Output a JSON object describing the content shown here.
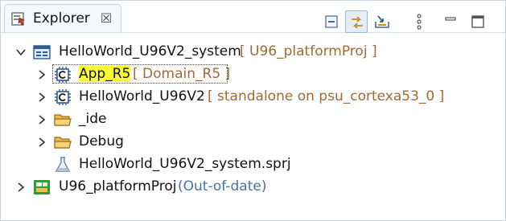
{
  "view": {
    "title": "Explorer",
    "close_glyph": "☒",
    "icons": {
      "view": "explorer-view-icon",
      "collapse_all": "collapse-all-icon",
      "link_with_editor": "link-with-editor-icon",
      "import": "import-icon",
      "menu": "view-menu-icon",
      "minimize": "minimize-icon",
      "maximize": "maximize-icon"
    }
  },
  "tree": [
    {
      "label": "HelloWorld_U96V2_system",
      "deco": "[ U96_platformProj ]",
      "deco_color": "#a06a34",
      "icon": "system-project-icon",
      "expanded": true
    },
    {
      "label": "App_R5",
      "deco": "[ Domain_R5 ]",
      "deco_color": "#a06a34",
      "icon": "application-project-icon",
      "expanded": false,
      "highlighted": true,
      "selected": true
    },
    {
      "label": "HelloWorld_U96V2",
      "deco": "[ standalone on psu_cortexa53_0 ]",
      "deco_color": "#a06a34",
      "icon": "application-project-icon",
      "expanded": false
    },
    {
      "label": "_ide",
      "deco": "",
      "icon": "folder-icon",
      "expanded": false
    },
    {
      "label": "Debug",
      "deco": "",
      "icon": "folder-icon",
      "expanded": false
    },
    {
      "label": "HelloWorld_U96V2_system.sprj",
      "deco": "",
      "icon": "flask-icon"
    },
    {
      "label": "U96_platformProj",
      "deco": "(Out-of-date)",
      "deco_color": "#4673a6",
      "icon": "platform-project-icon",
      "expanded": false
    }
  ],
  "colors": {
    "highlight": "#ffff33",
    "decoration_brown": "#a06a34",
    "decoration_blue": "#4673a6",
    "accent_blue": "#1f5fa8"
  }
}
